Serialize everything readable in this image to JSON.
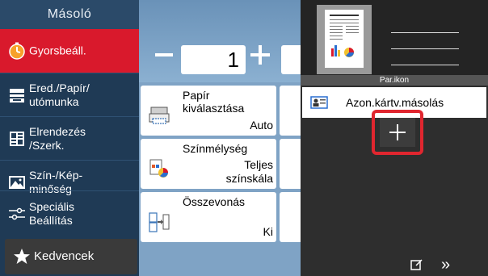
{
  "sidebar": {
    "title": "Másoló",
    "items": [
      {
        "label": "Gyorsbeáll.",
        "icon": "stopwatch-icon",
        "active": true
      },
      {
        "label": "Ered./Papír/\nutómunka",
        "icon": "paper-output-icon",
        "active": false
      },
      {
        "label": "Elrendezés\n/Szerk.",
        "icon": "layout-icon",
        "active": false
      },
      {
        "label": "Szín-/Kép-\nminőség",
        "icon": "image-quality-icon",
        "active": false
      },
      {
        "label": "Speciális\nBeállítás",
        "icon": "advanced-settings-icon",
        "active": false
      }
    ],
    "favorites_label": "Kedvencek",
    "favorites_icon": "star-icon"
  },
  "main": {
    "copies_value": "1",
    "tiles": [
      {
        "title": "Papír\nkiválasztása",
        "value": "Auto",
        "icon": "paper-tray-icon"
      },
      {
        "title": "Színmélység",
        "value": "Teljes\nszínskála",
        "icon": "color-mode-icon"
      },
      {
        "title": "Összevonás",
        "value": "Ki",
        "icon": "combine-icon"
      }
    ]
  },
  "panel": {
    "preview_bar_label": "Par.ikon",
    "list_item_label": "Azon.kártv.másolás",
    "list_item_icon": "id-card-icon",
    "add_button_symbol": "+",
    "footer_next_symbol": "»"
  },
  "colors": {
    "accent_red": "#d9192c",
    "sidebar_bg": "#1f3a55",
    "main_bg": "#7fa3c5",
    "panel_bg": "#2e2e2e"
  }
}
